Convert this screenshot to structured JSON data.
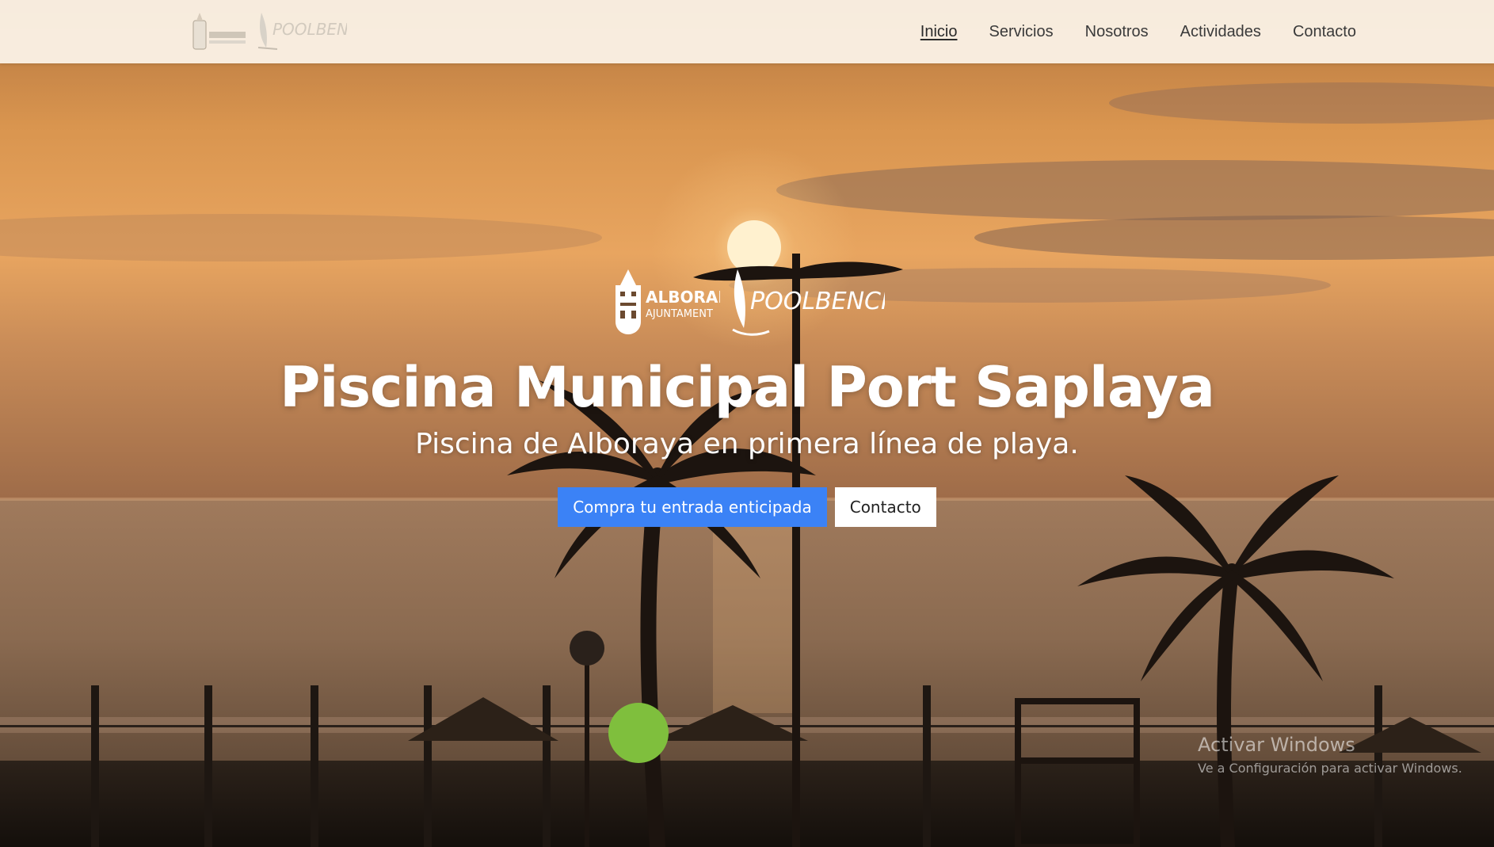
{
  "navbar": {
    "logo_alt": "Alboraia Ajuntament / Poolbench",
    "items": [
      {
        "label": "Inicio",
        "active": true
      },
      {
        "label": "Servicios",
        "active": false
      },
      {
        "label": "Nosotros",
        "active": false
      },
      {
        "label": "Actividades",
        "active": false
      },
      {
        "label": "Contacto",
        "active": false
      }
    ]
  },
  "hero": {
    "logo_left_text": "ALBORAIA",
    "logo_left_subtext": "AJUNTAMENT",
    "logo_right_text": "POOLBENCH",
    "title": "Piscina Municipal Port Saplaya",
    "subtitle": "Piscina de Alboraya en primera línea de playa.",
    "primary_button": "Compra tu entrada enticipada",
    "secondary_button": "Contacto"
  },
  "watermark": {
    "title": "Activar Windows",
    "text": "Ve a Configuración para activar Windows."
  },
  "colors": {
    "primary": "#3b82f6",
    "navbar_bg": "#fcf4ea",
    "sky_top": "#c98a4e",
    "sky_horizon": "#e8a158",
    "sea": "#6e5a48"
  },
  "icons": {
    "logo_left": "alboraia-crest-icon",
    "logo_right": "poolbench-sail-icon"
  }
}
